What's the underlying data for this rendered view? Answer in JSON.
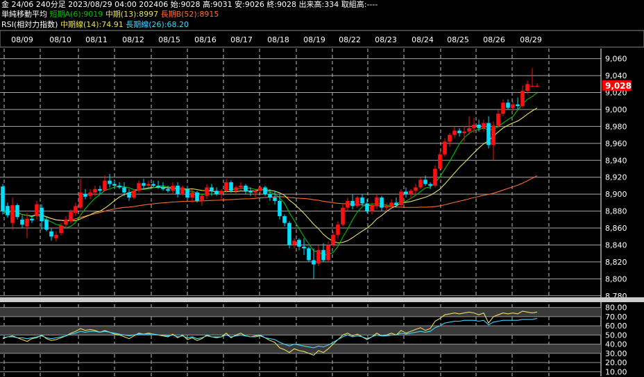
{
  "header": {
    "line1": "金 24/06 240分足 2023/08/29 04:00 202406 始:9028 高:9031 安:9026 終:9028 出来高:334 取組高:----",
    "ma_title": "単純移動平均",
    "ma_a": "短期A(6):9019",
    "ma_mid": "中期(13):8997",
    "ma_b": "長期B(52):8915",
    "rsi_title": "RSI(相対力指数)",
    "rsi_mid": "中期線(14):74.91",
    "rsi_long": "長期線(26):68.20"
  },
  "colors": {
    "up": "#ff1010",
    "down": "#00e0ff",
    "ma_short": "#00c000",
    "ma_mid": "#e6e060",
    "ma_long": "#ff6a2a",
    "rsi_mid": "#e6e060",
    "rsi_long": "#40d8ff",
    "price_tag": "#ff0000"
  },
  "chart_data": [
    {
      "type": "candlestick",
      "x_dates": [
        "08/09",
        "08/10",
        "08/11",
        "08/12",
        "08/15",
        "08/16",
        "08/17",
        "08/18",
        "08/19",
        "08/22",
        "08/23",
        "08/24",
        "08/25",
        "08/26",
        "08/29"
      ],
      "y_ticks": [
        9060,
        9040,
        9020,
        9000,
        8980,
        8960,
        8940,
        8920,
        8900,
        8880,
        8860,
        8840,
        8820,
        8800,
        8780
      ],
      "ylim": [
        8779,
        9072
      ],
      "current_price": "9,028",
      "grid": true,
      "candles": [
        [
          8909,
          8912,
          8876,
          8880
        ],
        [
          8886,
          8890,
          8872,
          8875
        ],
        [
          8866,
          8896,
          8858,
          8887
        ],
        [
          8887,
          8889,
          8870,
          8873
        ],
        [
          8870,
          8875,
          8860,
          8864
        ],
        [
          8862,
          8878,
          8848,
          8871
        ],
        [
          8871,
          8874,
          8866,
          8869
        ],
        [
          8874,
          8892,
          8870,
          8888
        ],
        [
          8884,
          8888,
          8858,
          8868
        ],
        [
          8870,
          8874,
          8856,
          8858
        ],
        [
          8856,
          8860,
          8845,
          8850
        ],
        [
          8848,
          8856,
          8844,
          8852
        ],
        [
          8854,
          8866,
          8851,
          8863
        ],
        [
          8864,
          8874,
          8860,
          8870
        ],
        [
          8868,
          8882,
          8865,
          8879
        ],
        [
          8878,
          8890,
          8874,
          8886
        ],
        [
          8884,
          8918,
          8882,
          8902
        ],
        [
          8900,
          8906,
          8894,
          8897
        ],
        [
          8898,
          8906,
          8894,
          8902
        ],
        [
          8902,
          8910,
          8898,
          8906
        ],
        [
          8906,
          8910,
          8900,
          8904
        ],
        [
          8904,
          8922,
          8904,
          8916
        ],
        [
          8916,
          8924,
          8908,
          8912
        ],
        [
          8912,
          8916,
          8906,
          8910
        ],
        [
          8910,
          8914,
          8906,
          8908
        ],
        [
          8908,
          8914,
          8898,
          8902
        ],
        [
          8902,
          8906,
          8892,
          8896
        ],
        [
          8896,
          8906,
          8894,
          8904
        ],
        [
          8904,
          8916,
          8902,
          8913
        ],
        [
          8913,
          8918,
          8906,
          8910
        ],
        [
          8910,
          8916,
          8908,
          8912
        ],
        [
          8912,
          8916,
          8908,
          8910
        ],
        [
          8910,
          8916,
          8906,
          8908
        ],
        [
          8908,
          8914,
          8904,
          8906
        ],
        [
          8906,
          8910,
          8902,
          8904
        ],
        [
          8904,
          8914,
          8900,
          8910
        ],
        [
          8910,
          8914,
          8896,
          8900
        ],
        [
          8900,
          8910,
          8898,
          8908
        ],
        [
          8906,
          8910,
          8892,
          8896
        ],
        [
          8896,
          8906,
          8890,
          8902
        ],
        [
          8902,
          8904,
          8890,
          8892
        ],
        [
          8892,
          8900,
          8886,
          8898
        ],
        [
          8898,
          8912,
          8894,
          8908
        ],
        [
          8908,
          8912,
          8898,
          8904
        ],
        [
          8904,
          8908,
          8898,
          8900
        ],
        [
          8900,
          8906,
          8894,
          8904
        ],
        [
          8904,
          8918,
          8902,
          8914
        ],
        [
          8914,
          8916,
          8902,
          8904
        ],
        [
          8904,
          8910,
          8900,
          8908
        ],
        [
          8908,
          8914,
          8904,
          8910
        ],
        [
          8910,
          8912,
          8900,
          8904
        ],
        [
          8904,
          8908,
          8898,
          8902
        ],
        [
          8902,
          8906,
          8896,
          8904
        ],
        [
          8904,
          8910,
          8900,
          8908
        ],
        [
          8908,
          8910,
          8898,
          8900
        ],
        [
          8900,
          8906,
          8892,
          8896
        ],
        [
          8896,
          8904,
          8888,
          8892
        ],
        [
          8892,
          8900,
          8870,
          8874
        ],
        [
          8874,
          8876,
          8862,
          8866
        ],
        [
          8866,
          8868,
          8836,
          8840
        ],
        [
          8840,
          8848,
          8836,
          8845
        ],
        [
          8846,
          8848,
          8834,
          8838
        ],
        [
          8838,
          8848,
          8828,
          8836
        ],
        [
          8836,
          8838,
          8820,
          8822
        ],
        [
          8822,
          8836,
          8800,
          8817
        ],
        [
          8818,
          8840,
          8815,
          8834
        ],
        [
          8834,
          8842,
          8820,
          8822
        ],
        [
          8822,
          8844,
          8820,
          8840
        ],
        [
          8840,
          8856,
          8838,
          8852
        ],
        [
          8852,
          8868,
          8848,
          8864
        ],
        [
          8864,
          8888,
          8862,
          8884
        ],
        [
          8884,
          8896,
          8880,
          8892
        ],
        [
          8892,
          8900,
          8882,
          8886
        ],
        [
          8886,
          8898,
          8884,
          8896
        ],
        [
          8896,
          8900,
          8886,
          8889
        ],
        [
          8889,
          8894,
          8878,
          8880
        ],
        [
          8880,
          8890,
          8876,
          8886
        ],
        [
          8886,
          8900,
          8882,
          8896
        ],
        [
          8896,
          8898,
          8880,
          8884
        ],
        [
          8884,
          8890,
          8880,
          8886
        ],
        [
          8886,
          8894,
          8882,
          8890
        ],
        [
          8890,
          8896,
          8884,
          8887
        ],
        [
          8887,
          8906,
          8884,
          8903
        ],
        [
          8903,
          8908,
          8896,
          8900
        ],
        [
          8900,
          8906,
          8894,
          8904
        ],
        [
          8904,
          8912,
          8898,
          8908
        ],
        [
          8908,
          8920,
          8906,
          8917
        ],
        [
          8917,
          8922,
          8910,
          8912
        ],
        [
          8912,
          8914,
          8906,
          8910
        ],
        [
          8910,
          8934,
          8908,
          8930
        ],
        [
          8930,
          8950,
          8928,
          8947
        ],
        [
          8947,
          8966,
          8944,
          8962
        ],
        [
          8962,
          8972,
          8956,
          8970
        ],
        [
          8970,
          8980,
          8966,
          8975
        ],
        [
          8975,
          8978,
          8968,
          8972
        ],
        [
          8972,
          8980,
          8962,
          8974
        ],
        [
          8974,
          8992,
          8970,
          8978
        ],
        [
          8978,
          8990,
          8972,
          8982
        ],
        [
          8982,
          8988,
          8974,
          8978
        ],
        [
          8978,
          8988,
          8974,
          8984
        ],
        [
          8984,
          8992,
          8954,
          8958
        ],
        [
          8958,
          8986,
          8940,
          8981
        ],
        [
          8981,
          9000,
          8978,
          8995
        ],
        [
          8995,
          9012,
          8992,
          9008
        ],
        [
          9008,
          9012,
          9000,
          9002
        ],
        [
          9002,
          9010,
          8998,
          9006
        ],
        [
          9006,
          9014,
          9000,
          9004
        ],
        [
          9004,
          9028,
          9002,
          9022
        ],
        [
          9022,
          9034,
          9018,
          9030
        ],
        [
          9028,
          9049,
          9026,
          9028
        ],
        [
          9028,
          9031,
          9026,
          9028
        ]
      ]
    },
    {
      "type": "line",
      "title": "RSI",
      "y_ticks": [
        80,
        70,
        60,
        50,
        40,
        30,
        20,
        10
      ],
      "ylim": [
        5,
        85
      ],
      "series": [
        {
          "name": "中期線(14)",
          "values": [
            46,
            48,
            49,
            47,
            45,
            43,
            46,
            47,
            50,
            46,
            44,
            45,
            47,
            49,
            52,
            54,
            57,
            55,
            56,
            55,
            53,
            55,
            53,
            51,
            50,
            48,
            46,
            49,
            52,
            51,
            52,
            51,
            50,
            49,
            48,
            51,
            47,
            50,
            45,
            47,
            44,
            46,
            50,
            48,
            47,
            48,
            52,
            47,
            50,
            52,
            49,
            48,
            49,
            50,
            47,
            44,
            42,
            36,
            34,
            31,
            35,
            33,
            32,
            30,
            28,
            33,
            31,
            35,
            40,
            45,
            50,
            52,
            49,
            51,
            48,
            45,
            48,
            52,
            49,
            50,
            52,
            50,
            55,
            52,
            54,
            56,
            58,
            55,
            57,
            65,
            68,
            72,
            73,
            74,
            73,
            74,
            75,
            74,
            72,
            74,
            63,
            70,
            72,
            74,
            73,
            74,
            73,
            76,
            75,
            74,
            75
          ]
        },
        {
          "name": "長期線(26)",
          "values": [
            47,
            48,
            48,
            47,
            47,
            46,
            47,
            48,
            49,
            47,
            46,
            47,
            48,
            49,
            51,
            52,
            54,
            53,
            54,
            54,
            53,
            54,
            53,
            52,
            51,
            50,
            49,
            50,
            51,
            51,
            51,
            51,
            50,
            50,
            49,
            50,
            48,
            49,
            47,
            48,
            46,
            47,
            49,
            48,
            48,
            48,
            50,
            48,
            49,
            50,
            49,
            48,
            48,
            49,
            47,
            46,
            45,
            42,
            40,
            38,
            40,
            39,
            38,
            37,
            36,
            38,
            37,
            39,
            42,
            45,
            48,
            50,
            48,
            49,
            48,
            46,
            48,
            50,
            49,
            49,
            50,
            50,
            52,
            51,
            52,
            53,
            54,
            53,
            54,
            58,
            60,
            63,
            64,
            65,
            65,
            66,
            66,
            66,
            65,
            66,
            61,
            64,
            65,
            66,
            66,
            66,
            66,
            67,
            67,
            67,
            68
          ]
        }
      ]
    }
  ]
}
